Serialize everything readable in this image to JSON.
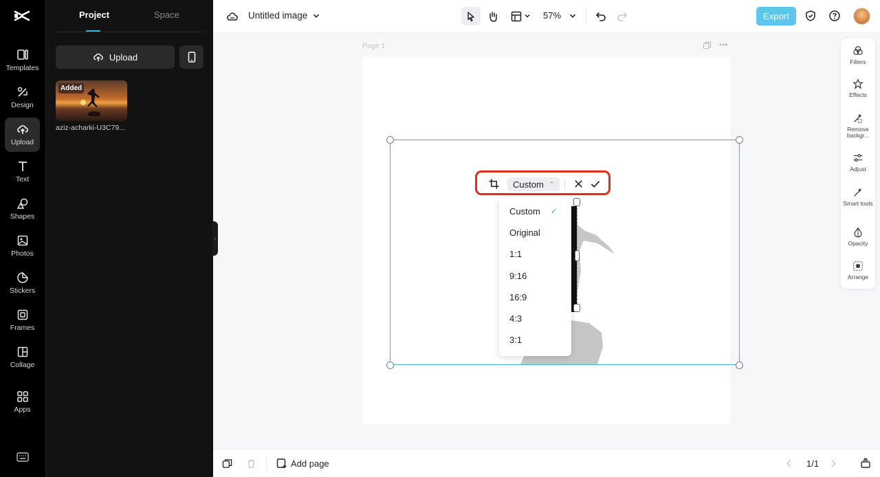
{
  "rail": {
    "items": [
      {
        "label": "Templates",
        "icon": "templates-icon"
      },
      {
        "label": "Design",
        "icon": "design-icon"
      },
      {
        "label": "Upload",
        "icon": "upload-icon"
      },
      {
        "label": "Text",
        "icon": "text-icon"
      },
      {
        "label": "Shapes",
        "icon": "shapes-icon"
      },
      {
        "label": "Photos",
        "icon": "photos-icon"
      },
      {
        "label": "Stickers",
        "icon": "stickers-icon"
      },
      {
        "label": "Frames",
        "icon": "frames-icon"
      },
      {
        "label": "Collage",
        "icon": "collage-icon"
      },
      {
        "label": "Apps",
        "icon": "apps-icon"
      }
    ],
    "active": "Upload"
  },
  "panel": {
    "tabs": [
      "Project",
      "Space"
    ],
    "upload_label": "Upload",
    "asset": {
      "badge": "Added",
      "name": "aziz-acharki-U3C79..."
    }
  },
  "topbar": {
    "title": "Untitled image",
    "zoom": "57%",
    "export_label": "Export"
  },
  "canvas": {
    "page_label": "Page 1"
  },
  "crop": {
    "ratio": "Custom",
    "options": [
      "Custom",
      "Original",
      "1:1",
      "9:16",
      "16:9",
      "4:3",
      "3:1"
    ],
    "selected": "Custom"
  },
  "right_rail": {
    "items": [
      {
        "label": "Filters",
        "icon": "filters-icon"
      },
      {
        "label": "Effects",
        "icon": "effects-icon"
      },
      {
        "label": "Remove backgr...",
        "icon": "remove-background-icon"
      },
      {
        "label": "Adjust",
        "icon": "adjust-icon"
      },
      {
        "label": "Smart tools",
        "icon": "smart-tools-icon"
      },
      {
        "label": "Opacity",
        "icon": "opacity-icon"
      },
      {
        "label": "Arrange",
        "icon": "arrange-icon"
      }
    ]
  },
  "bottom": {
    "add_page_label": "Add page",
    "page_count": "1/1"
  },
  "colors": {
    "accent": "#22c3e6",
    "export": "#5dc6ec",
    "selection": "#3bb6d6",
    "highlight": "#e22d1d"
  }
}
